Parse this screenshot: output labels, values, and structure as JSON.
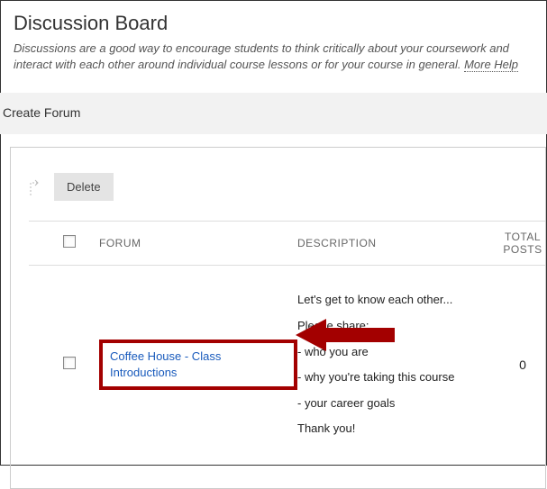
{
  "header": {
    "title": "Discussion Board",
    "description": "Discussions are a good way to encourage students to think critically about your coursework and interact with each other around individual course lessons or for your course in general.",
    "more_help": "More Help"
  },
  "toolbar": {
    "create_forum": "Create Forum"
  },
  "actions": {
    "delete": "Delete"
  },
  "columns": {
    "forum": "FORUM",
    "description": "DESCRIPTION",
    "total_posts": "TOTAL POSTS"
  },
  "forums": [
    {
      "title": "Coffee House - Class Introductions",
      "description_lines": [
        "Let's get to know each other...",
        "Please share:",
        "- who you are",
        "",
        "- why you're taking this course",
        "- your career goals",
        "Thank you!"
      ],
      "total_posts": "0"
    }
  ]
}
